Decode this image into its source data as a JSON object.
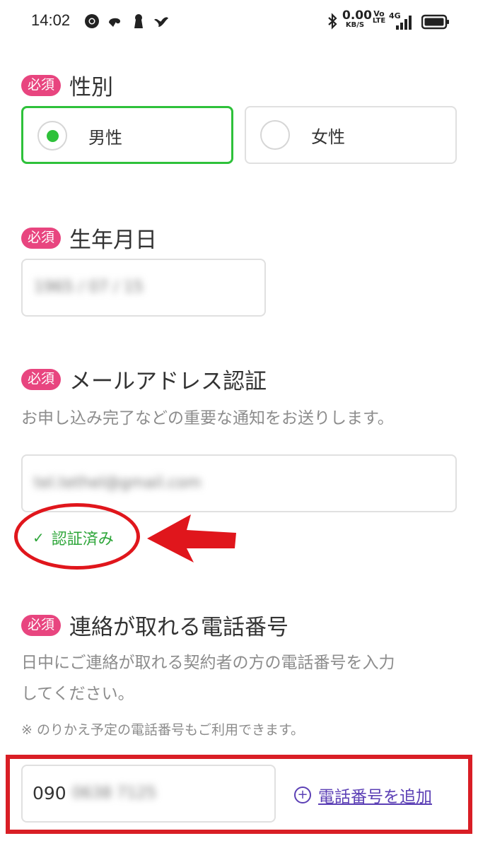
{
  "status_bar": {
    "time": "14:02",
    "speed_value": "0.00",
    "speed_unit": "KB/S",
    "volte_top": "Vo",
    "volte_bottom": "LTE",
    "network": "4G",
    "icons": [
      "chrome-icon",
      "app-icon",
      "keyhole-icon",
      "app-icon",
      "bluetooth-icon",
      "signal-icon",
      "battery-icon"
    ]
  },
  "required_badge": "必須",
  "gender": {
    "label": "性別",
    "options": [
      {
        "label": "男性",
        "selected": true
      },
      {
        "label": "女性",
        "selected": false
      }
    ]
  },
  "birthdate": {
    "label": "生年月日",
    "value": "1965 / 07 / 15"
  },
  "email": {
    "label": "メールアドレス認証",
    "description": "お申し込み完了などの重要な通知をお送りします。",
    "value": "tel.tethel@gmail.com",
    "status": "認証済み"
  },
  "phone": {
    "label": "連絡が取れる電話番号",
    "description_line1": "日中にご連絡が取れる契約者の方の電話番号を入力",
    "description_line2": "してください。",
    "note": "※ のりかえ予定の電話番号もご利用できます。",
    "value_prefix": "090",
    "value_rest": "0638 7125",
    "add_label": "電話番号を追加"
  },
  "colors": {
    "badge": "#e8457f",
    "selected": "#2ec13a",
    "verified": "#2ea63a",
    "link": "#5b3fb5",
    "annotation": "#d91e25"
  }
}
